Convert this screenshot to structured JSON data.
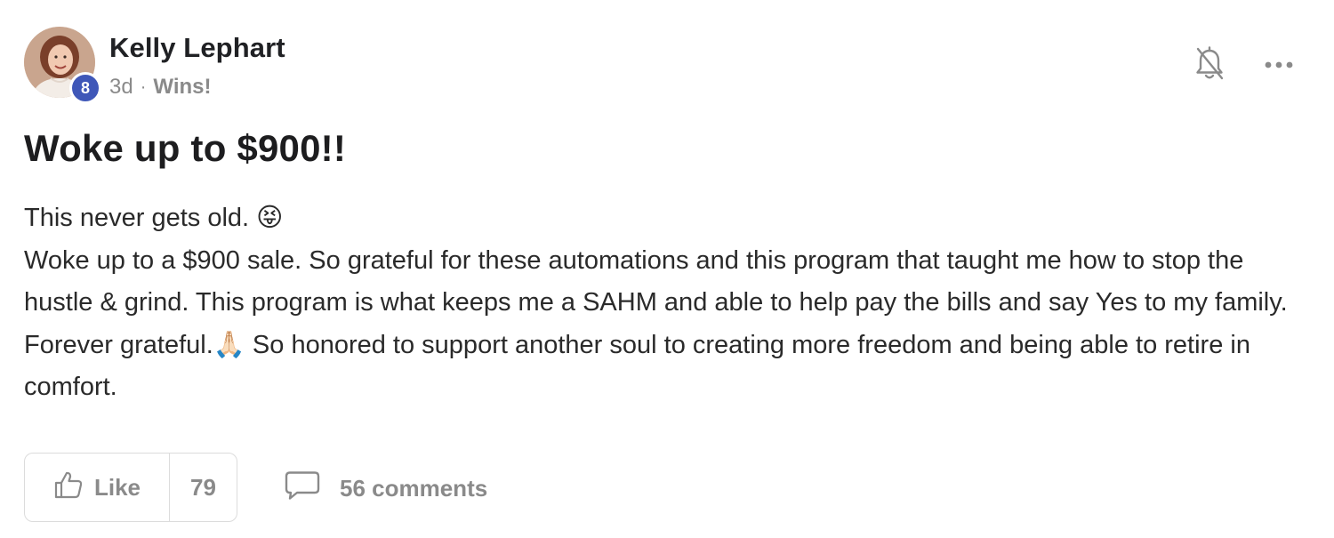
{
  "post": {
    "author": {
      "name": "Kelly Lephart",
      "level": "8"
    },
    "meta": {
      "time": "3d",
      "separator": "·",
      "category": "Wins!"
    },
    "title": "Woke up to $900!!",
    "body": {
      "line1": "This never gets old. 😝",
      "paragraph": "Woke up to a $900 sale. So grateful for these automations and this program that taught me how to stop the hustle & grind. This program is what keeps me a SAHM and able to help pay the bills and say Yes to my family. Forever grateful.🙏🏻 So honored to support another soul to creating more freedom and being able to retire in comfort."
    },
    "actions": {
      "like_label": "Like",
      "like_count": "79",
      "comments_label": "56 comments"
    }
  },
  "icons": {
    "notification": "bell-off-icon",
    "more": "more-horizontal-icon",
    "like": "thumbs-up-icon",
    "comment": "comment-bubble-icon"
  },
  "colors": {
    "badge": "#3f57b8",
    "muted_text": "#8a8a8a",
    "title_text": "#1d1d1f"
  }
}
